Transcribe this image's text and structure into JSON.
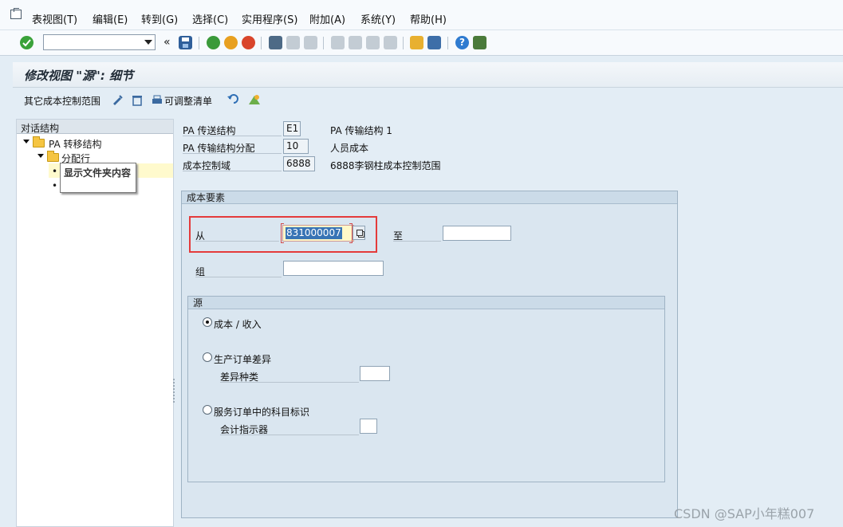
{
  "menu": {
    "items": [
      "表视图(T)",
      "编辑(E)",
      "转到(G)",
      "选择(C)",
      "实用程序(S)",
      "附加(A)",
      "系统(Y)",
      "帮助(H)"
    ]
  },
  "toolbar": {
    "command_value": "",
    "back_symbol": "«"
  },
  "title": "修改视图 \"源\": 细节",
  "app_toolbar": {
    "other_area_label": "其它成本控制范围",
    "adjustable_list_label": "可调整清单"
  },
  "nav": {
    "header": "对话结构",
    "root_label": "PA 转移结构",
    "child_label": "分配行",
    "tooltip": "显示文件夹内容",
    "bullet1": "•",
    "bullet2": "•"
  },
  "header_fields": {
    "row1_label": "PA 传送结构",
    "row1_value": "E1",
    "row1_desc": "PA 传输结构 1",
    "row2_label": "PA 传输结构分配",
    "row2_value": "10",
    "row2_desc": "人员成本",
    "row3_label": "成本控制域",
    "row3_value": "6888",
    "row3_desc": "6888李钢柱成本控制范围"
  },
  "cost_elements": {
    "title": "成本要素",
    "from_label": "从",
    "from_value": "831000007",
    "to_label": "至",
    "to_value": "",
    "group_label": "组",
    "group_value": ""
  },
  "source": {
    "title": "源",
    "option1": "成本 / 收入",
    "option2": "生产订单差异",
    "variance_label": "差异种类",
    "variance_value": "",
    "option3": "服务订单中的科目标识",
    "account_label": "会计指示器",
    "account_value": "",
    "selected": 1
  },
  "watermark": "CSDN @SAP小年糕007",
  "colors": {
    "highlight_border": "#e43b3b",
    "selection": "#3874b5"
  }
}
